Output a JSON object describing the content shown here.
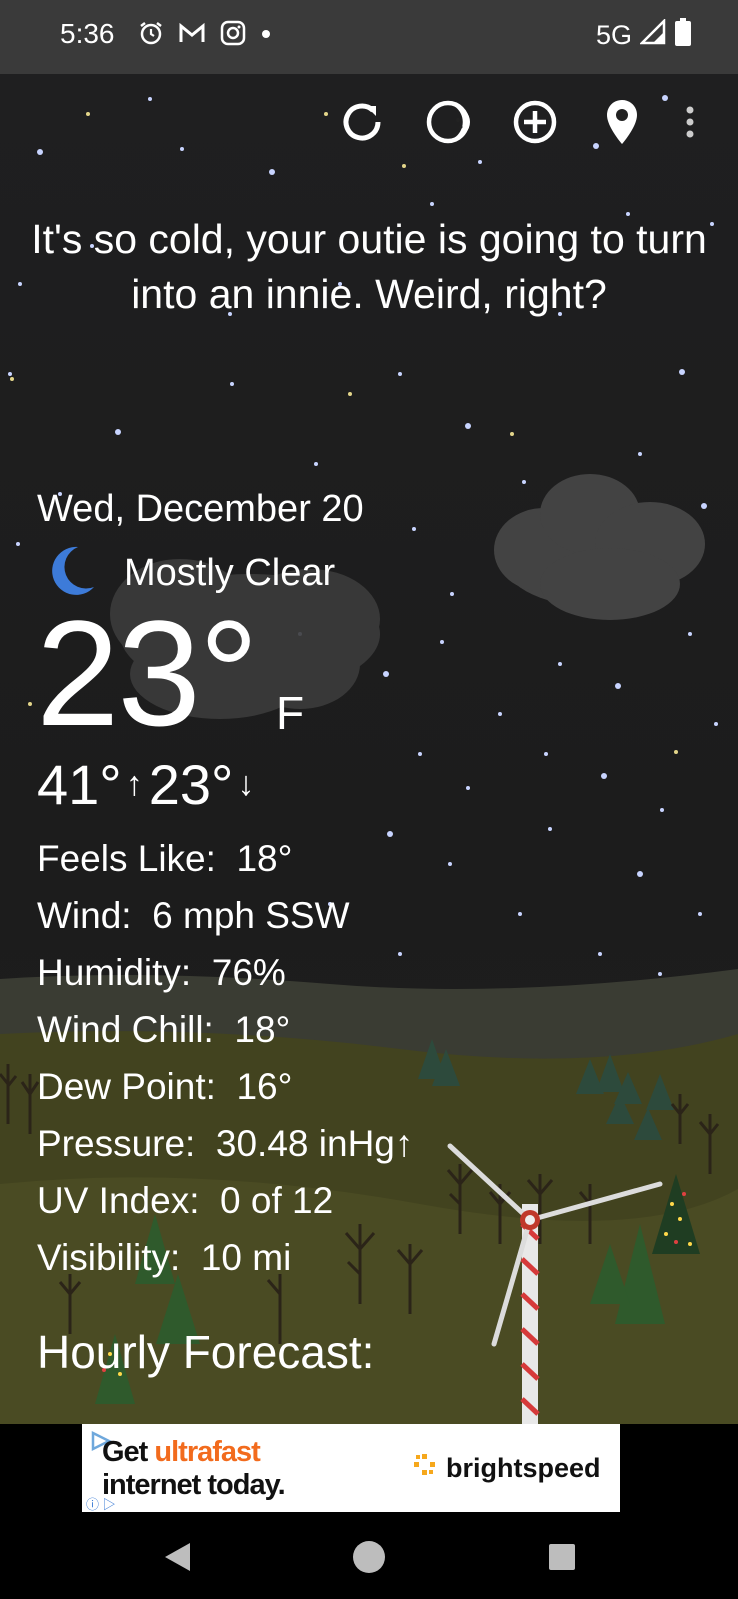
{
  "status_bar": {
    "time": "5:36",
    "network": "5G",
    "icons": [
      "alarm-icon",
      "gmail-icon",
      "instagram-icon",
      "dot-icon",
      "signal-icon",
      "battery-icon"
    ]
  },
  "toolbar": {
    "icons": [
      "refresh-icon",
      "moon-phase-icon",
      "add-location-icon",
      "location-pin-icon",
      "overflow-menu-icon"
    ]
  },
  "joke": "It's so cold, your outie is going to turn into an innie. Weird, right?",
  "weather": {
    "date": "Wed, December 20",
    "condition": "Mostly Clear",
    "condition_icon": "crescent-moon-icon",
    "temperature": "23°",
    "unit": "F",
    "high": "41°",
    "low": "23°",
    "details": [
      {
        "label": "Feels Like:",
        "value": "18°"
      },
      {
        "label": "Wind:",
        "value": "6 mph SSW"
      },
      {
        "label": "Humidity:",
        "value": "76%"
      },
      {
        "label": "Wind Chill:",
        "value": "18°"
      },
      {
        "label": "Dew Point:",
        "value": "16°"
      },
      {
        "label": "Pressure:",
        "value": "30.48 inHg↑"
      },
      {
        "label": "UV Index:",
        "value": "0 of 12"
      },
      {
        "label": "Visibility:",
        "value": "10 mi"
      }
    ]
  },
  "hourly_heading": "Hourly Forecast:",
  "ad": {
    "line1_prefix": "Get ",
    "line1_highlight": "ultrafast",
    "line2": "internet today.",
    "brand": "brightspeed",
    "colors": {
      "highlight": "#f26b1d",
      "brand_accent": "#f6a81c"
    }
  },
  "nav": {
    "icons": [
      "back-icon",
      "home-icon",
      "recents-icon"
    ]
  },
  "colors": {
    "moon": "#3d7bd9",
    "status_bg": "#3a3a3a",
    "sky": "#1f1f20",
    "ground": "#3b3a1f"
  }
}
